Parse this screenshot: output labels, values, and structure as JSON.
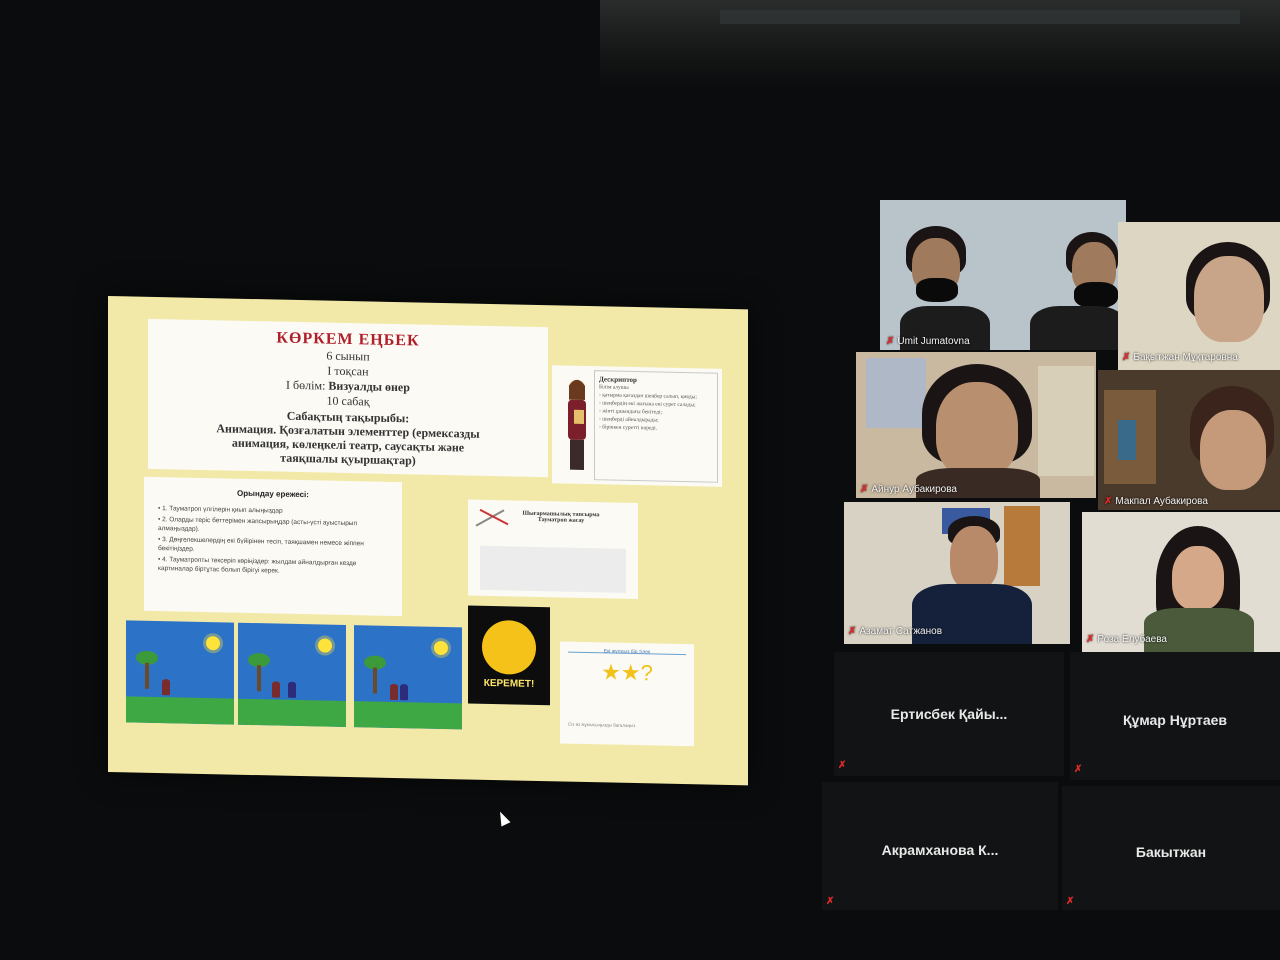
{
  "slide": {
    "title": "КӨРКЕМ ЕҢБЕК",
    "grade": "6 сынып",
    "quarter": "I тоқсан",
    "section_prefix": "I бөлім:",
    "section_name": "Визуалды өнер",
    "lesson": "10 сабақ",
    "topic_label": "Сабақтың тақырыбы:",
    "topic_line1": "Анимация. Қозғалатын элементтер (ермексазды",
    "topic_line2": "анимация, көлеңкелі театр, саусақты және",
    "topic_line3": "таяқшалы қуыршақтар)",
    "descriptor_title": "Дескриптор",
    "descriptor_lines": [
      "Білім алушы",
      "- қатырма қағаздан шеңбер салып, қияды;",
      "- шеңбердің екі жағына екі сурет салады;",
      "- жіпті ұшындағы бекітеді;",
      "- шеңберді айналдырады;",
      "- біріккен суретті көреді."
    ],
    "rules_title": "Орындау ережесі:",
    "rules": [
      "• 1. Тауматроп үлгілерін қиып алыңыздар",
      "• 2. Оларды теріс беттерімен жапсырыңдар (асты-үсті ауыстырып алмаңыздар).",
      "• 3. Дөңгелекшелердің екі бүйірінен тесіп, таяқшамен немесе жіппен бекітіңіздер.",
      "• 4. Тауматропты тексеріп көріңіздер: жылдам айналдырған кезде картиналар біртұтас болып бірігуі керек."
    ],
    "steps_caption": "Шығармашылық тапсырма Тауматроп жасау",
    "keremet_label": "КЕРЕМЕТ!",
    "stars_heading": "Екі жұлдыз бір тілек",
    "stars_symbols": "★★?",
    "stars_note": "Сіз өз жұмысыңызды бағалаңыз"
  },
  "participants": [
    {
      "name": "Umit Jumatovna"
    },
    {
      "name": "Бақытжан Мұқтаровна"
    },
    {
      "name": "Айнур Аубакирова"
    },
    {
      "name": "Макпал Аубакирова"
    },
    {
      "name": "Азамат Сатжанов"
    },
    {
      "name": "Роза Елубаева"
    }
  ],
  "blank_participants": [
    {
      "name": "Ертисбек Қайы..."
    },
    {
      "name": "Құмар Нұртаев"
    },
    {
      "name": "Акрамханова  К..."
    },
    {
      "name": "Бакытжан"
    }
  ],
  "icons": {
    "muted": "✗"
  },
  "colors": {
    "slide_bg": "#f2e9a8",
    "title_red": "#b01e2a",
    "mic_red": "#e02a2a"
  }
}
